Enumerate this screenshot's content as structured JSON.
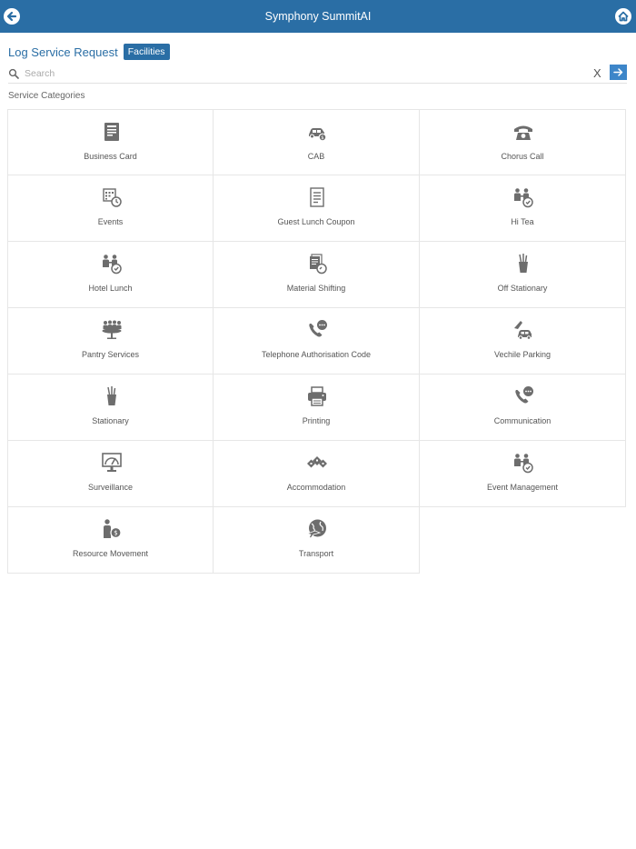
{
  "app": {
    "title": "Symphony SummitAI"
  },
  "header": {
    "page_title": "Log Service Request",
    "module_badge": "Facilities"
  },
  "search": {
    "placeholder": "Search",
    "value": "",
    "clear_label": "X"
  },
  "section_label": "Service Categories",
  "categories": [
    {
      "label": "Business Card",
      "icon": "business-card"
    },
    {
      "label": "CAB",
      "icon": "car"
    },
    {
      "label": "Chorus Call",
      "icon": "telephone"
    },
    {
      "label": "Events",
      "icon": "calendar-clock"
    },
    {
      "label": "Guest Lunch Coupon",
      "icon": "coupon"
    },
    {
      "label": "Hi Tea",
      "icon": "people-meeting"
    },
    {
      "label": "Hotel Lunch",
      "icon": "people-meeting"
    },
    {
      "label": "Material Shifting",
      "icon": "documents-check"
    },
    {
      "label": "Off Stationary",
      "icon": "pen-holder"
    },
    {
      "label": "Pantry Services",
      "icon": "group-table"
    },
    {
      "label": "Telephone Authorisation Code",
      "icon": "phone-chat"
    },
    {
      "label": "Vechile Parking",
      "icon": "parking-car"
    },
    {
      "label": "Stationary",
      "icon": "pen-holder"
    },
    {
      "label": "Printing",
      "icon": "printer"
    },
    {
      "label": "Communication",
      "icon": "phone-chat"
    },
    {
      "label": "Surveillance",
      "icon": "monitor-gauge"
    },
    {
      "label": "Accommodation",
      "icon": "houses"
    },
    {
      "label": "Event Management",
      "icon": "people-meeting"
    },
    {
      "label": "Resource Movement",
      "icon": "person-money"
    },
    {
      "label": "Transport",
      "icon": "globe-plane"
    }
  ],
  "colors": {
    "primary": "#2a6ea5",
    "accent": "#3d86c9",
    "icon": "#6d6d6d"
  }
}
